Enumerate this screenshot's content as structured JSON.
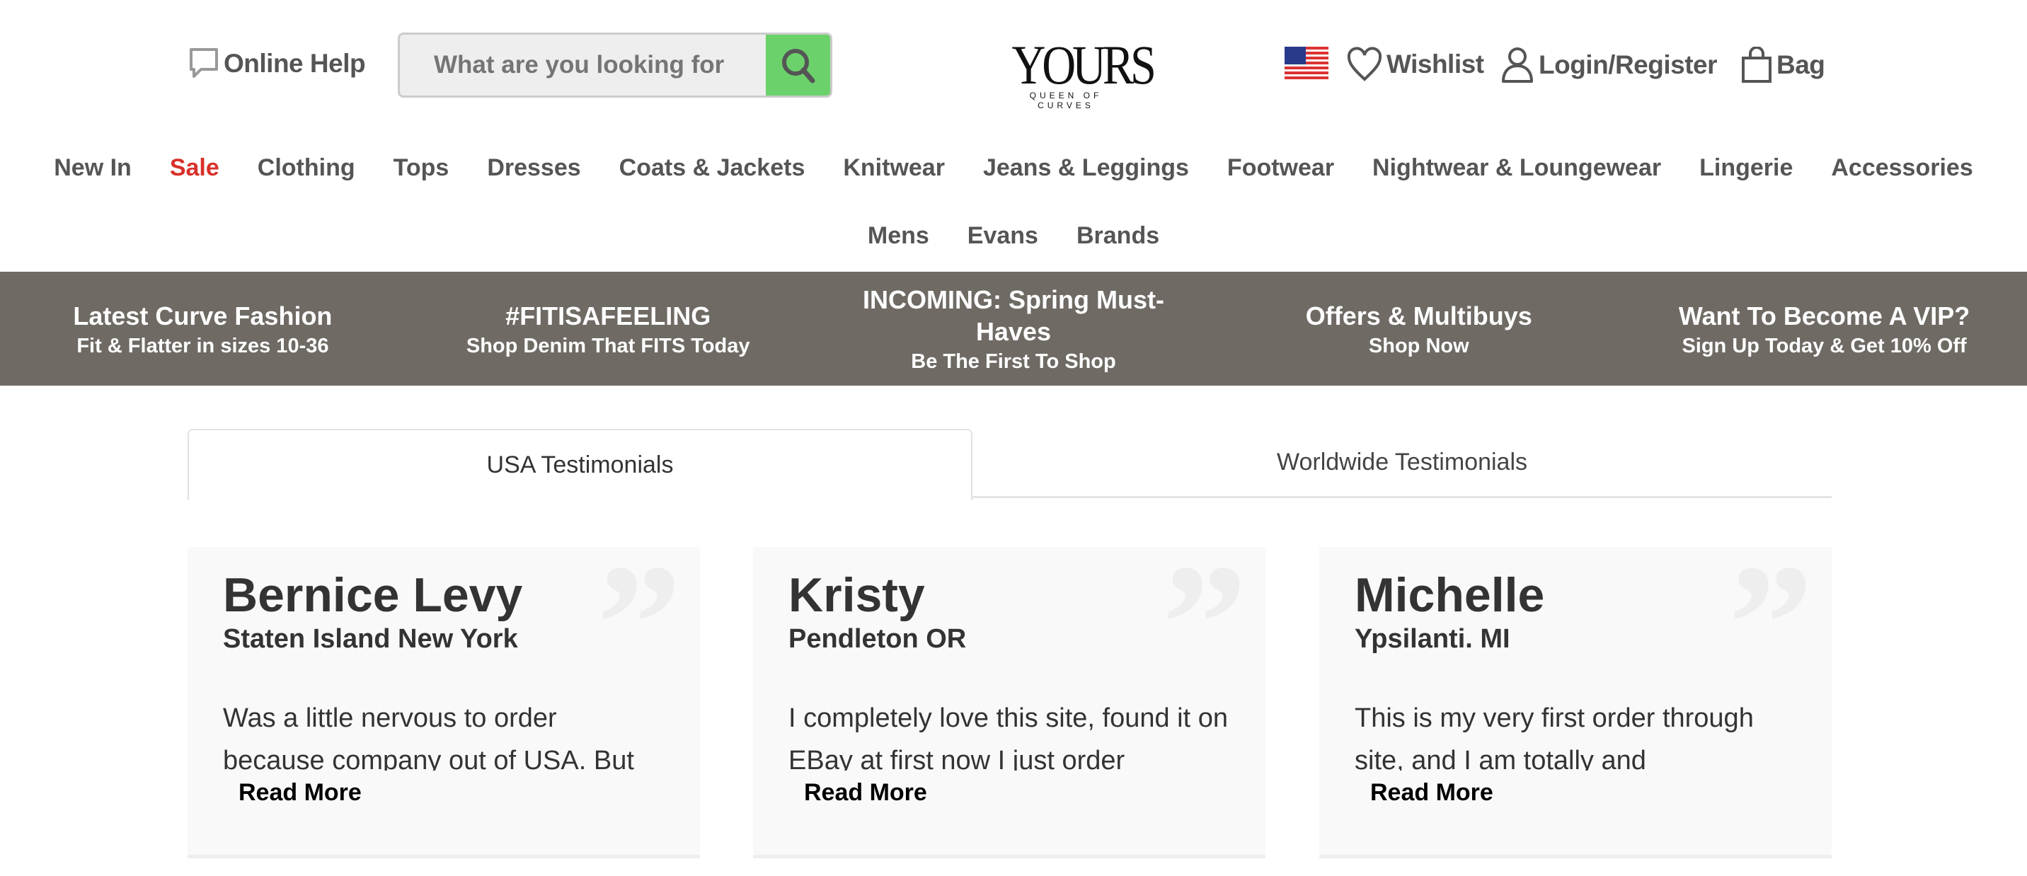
{
  "header": {
    "online_help": "Online Help",
    "search_placeholder": "What are you looking for",
    "logo": {
      "text": "YOURS",
      "tagline": "QUEEN OF CURVES"
    },
    "country": "USA",
    "wishlist": "Wishlist",
    "login": "Login/Register",
    "bag": "Bag",
    "accent_color": "#6bd26b"
  },
  "nav": {
    "row1": [
      "New In",
      "Sale",
      "Clothing",
      "Tops",
      "Dresses",
      "Coats & Jackets",
      "Knitwear",
      "Jeans & Leggings",
      "Footwear",
      "Nightwear & Loungewear",
      "Lingerie",
      "Accessories"
    ],
    "row2": [
      "Mens",
      "Evans",
      "Brands"
    ],
    "sale_color": "#d9302a"
  },
  "banner": [
    {
      "title": "Latest Curve Fashion",
      "sub": "Fit & Flatter in sizes 10-36"
    },
    {
      "title": "#FITISAFEELING",
      "sub": "Shop Denim That FITS Today"
    },
    {
      "title": "INCOMING: Spring Must-Haves",
      "sub": "Be The First To Shop"
    },
    {
      "title": "Offers & Multibuys",
      "sub": "Shop Now"
    },
    {
      "title": "Want To Become A VIP?",
      "sub": "Sign Up Today & Get 10% Off"
    }
  ],
  "tabs": [
    {
      "label": "USA Testimonials",
      "active": true
    },
    {
      "label": "Worldwide Testimonials",
      "active": false
    }
  ],
  "testimonials": [
    {
      "name": "Bernice Levy",
      "location": "Staten Island New York",
      "text": "Was a little nervous to order because company out of USA. But",
      "more": "Read More"
    },
    {
      "name": "Kristy",
      "location": "Pendleton OR",
      "text": "I completely love this site, found it on EBay at first now I just order",
      "more": "Read More"
    },
    {
      "name": "Michelle",
      "location": "Ypsilanti. MI",
      "text": "This is my very first order through site, and I am totally and",
      "more": "Read More"
    }
  ]
}
